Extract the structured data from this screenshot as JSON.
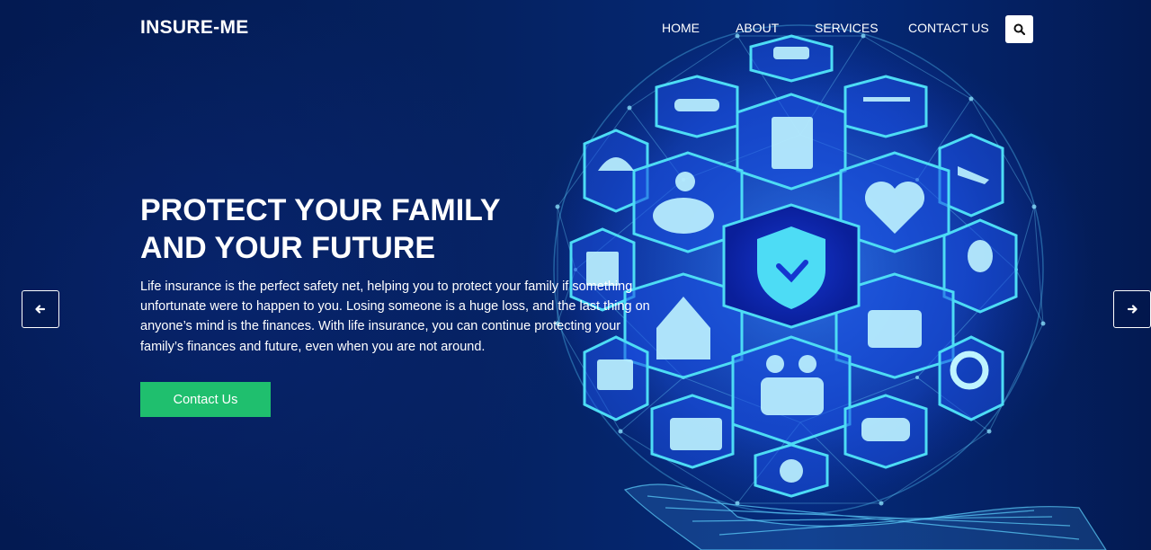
{
  "brand": {
    "logo": "INSURE-ME"
  },
  "nav": {
    "items": [
      {
        "label": "HOME"
      },
      {
        "label": "ABOUT"
      },
      {
        "label": "SERVICES"
      },
      {
        "label": "CONTACT US"
      }
    ],
    "search_icon": "search-icon"
  },
  "hero": {
    "headline_line1": "PROTECT YOUR FAMILY",
    "headline_line2": "AND YOUR FUTURE",
    "description": "Life insurance is the perfect safety net, helping you to protect your family if something unfortunate were to happen to you. Losing someone is a huge loss, and the last thing on anyone’s mind is the finances. With life insurance, you can continue protecting your family’s finances and future, even when you are not around.",
    "cta_label": "Contact Us"
  },
  "carousel": {
    "prev_icon": "arrow-left-icon",
    "next_icon": "arrow-right-icon"
  },
  "colors": {
    "background": "#031a52",
    "accent_button": "#1fbf6e",
    "globe_glow": "#2f7bff",
    "hex_cyan": "#3ad6f0"
  },
  "illustration": {
    "icons": [
      "ship-icon",
      "handshake-icon",
      "scales-icon",
      "umbrella-icon",
      "clipboard-icon",
      "airplane-icon",
      "piggy-bank-icon",
      "heart-pulse-icon",
      "book-icon",
      "shield-check-icon",
      "lightbulb-icon",
      "house-icon",
      "wallet-icon",
      "medical-kit-icon",
      "family-icon",
      "lifebuoy-icon",
      "briefcase-icon",
      "car-icon",
      "globe-icon"
    ]
  }
}
